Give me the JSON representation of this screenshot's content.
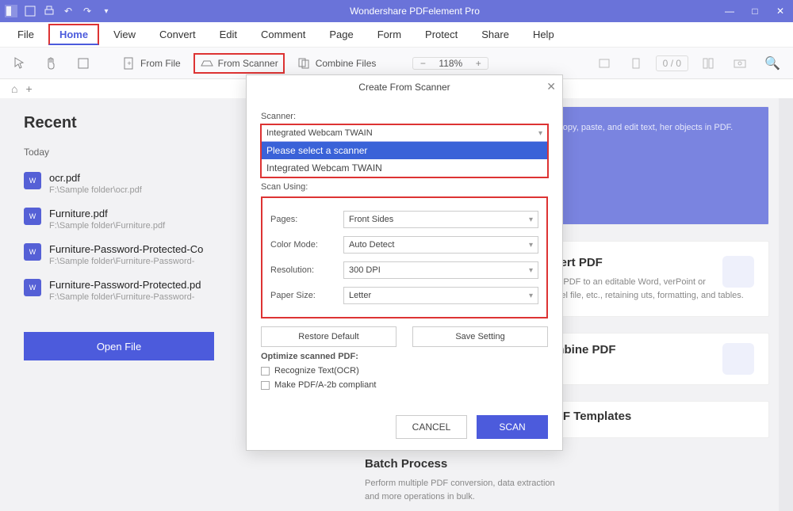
{
  "titlebar": {
    "title": "Wondershare PDFelement Pro"
  },
  "menu": {
    "items": [
      "File",
      "Home",
      "View",
      "Convert",
      "Edit",
      "Comment",
      "Page",
      "Form",
      "Protect",
      "Share",
      "Help"
    ],
    "active": "Home"
  },
  "toolbar": {
    "from_file": "From File",
    "from_scanner": "From Scanner",
    "combine": "Combine Files",
    "zoom": "118%",
    "page_current": "0",
    "page_sep": "/",
    "page_total": "0"
  },
  "recent": {
    "title": "Recent",
    "today": "Today",
    "files": [
      {
        "name": "ocr.pdf",
        "path": "F:\\Sample folder\\ocr.pdf"
      },
      {
        "name": "Furniture.pdf",
        "path": "F:\\Sample folder\\Furniture.pdf"
      },
      {
        "name": "Furniture-Password-Protected-Co",
        "path": "F:\\Sample folder\\Furniture-Password-"
      },
      {
        "name": "Furniture-Password-Protected.pd",
        "path": "F:\\Sample folder\\Furniture-Password-"
      }
    ],
    "open_btn": "Open File"
  },
  "cards": {
    "edit": {
      "title": "",
      "body": "ut, copy, paste, and edit text, her objects in PDF."
    },
    "convert": {
      "title": "nvert PDF",
      "body": "vert PDF to an editable Word, verPoint or Excel file, etc., retaining uts, formatting, and tables."
    },
    "combine": {
      "title": "umbine PDF"
    },
    "templates": {
      "title": "PDF Templates"
    }
  },
  "batch": {
    "title": "Batch Process",
    "body": "Perform multiple PDF conversion, data extraction and more operations in bulk."
  },
  "dialog": {
    "title": "Create From Scanner",
    "scanner_label": "Scanner:",
    "scanner_value": "Integrated Webcam TWAIN",
    "scanner_options": [
      "Please select a scanner",
      "Integrated Webcam TWAIN"
    ],
    "scan_using": "Scan Using:",
    "pages_label": "Pages:",
    "pages_value": "Front Sides",
    "color_label": "Color Mode:",
    "color_value": "Auto Detect",
    "res_label": "Resolution:",
    "res_value": "300 DPI",
    "paper_label": "Paper Size:",
    "paper_value": "Letter",
    "restore": "Restore Default",
    "save": "Save Setting",
    "optimize": "Optimize scanned PDF:",
    "ocr": "Recognize Text(OCR)",
    "pdfa": "Make PDF/A-2b compliant",
    "cancel": "CANCEL",
    "scan": "SCAN"
  }
}
